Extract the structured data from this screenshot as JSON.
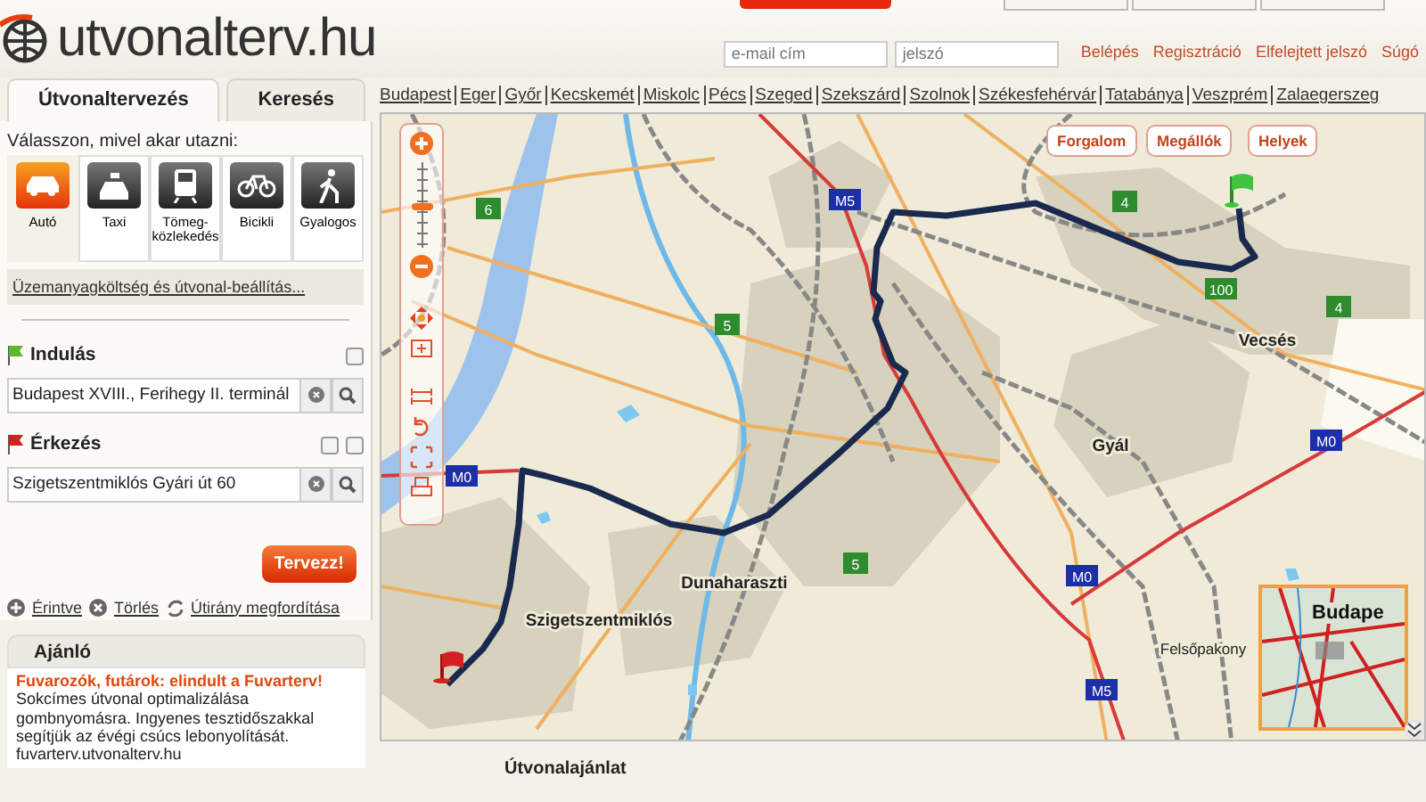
{
  "logo": "utvonalterv.hu",
  "login": {
    "email_placeholder": "e-mail cím",
    "password_placeholder": "jelszó",
    "links": [
      "Belépés",
      "Regisztráció",
      "Elfelejtett jelszó",
      "Súgó"
    ]
  },
  "city_links": [
    "Budapest",
    "Eger",
    "Győr",
    "Kecskemét",
    "Miskolc",
    "Pécs",
    "Szeged",
    "Szekszárd",
    "Szolnok",
    "Székesfehérvár",
    "Tatabánya",
    "Veszprém",
    "Zalaegerszeg"
  ],
  "tabs": [
    {
      "label": "Útvonaltervezés",
      "selected": true
    },
    {
      "label": "Keresés",
      "selected": false
    }
  ],
  "mode_prompt": "Válasszon, mivel akar utazni:",
  "modes": [
    {
      "label": "Autó",
      "kind": "car",
      "selected": true
    },
    {
      "label": "Taxi",
      "kind": "taxi",
      "selected": false
    },
    {
      "label": "Tömeg-közlekedés",
      "kind": "train",
      "selected": false
    },
    {
      "label": "Bicikli",
      "kind": "bike",
      "selected": false
    },
    {
      "label": "Gyalogos",
      "kind": "walk",
      "selected": false
    }
  ],
  "settings_link": "Üzemanyagköltség és útvonal-beállítás...",
  "origin": {
    "label": "Indulás",
    "value": "Budapest XVIII., Ferihegy II. terminál",
    "kind": "origin"
  },
  "destination": {
    "label": "Érkezés",
    "value": "Szigetszentmiklós Gyári út 60",
    "kind": "destination"
  },
  "plan_button": "Tervezz!",
  "actions": [
    {
      "label": "Érintve",
      "kind": "add"
    },
    {
      "label": "Törlés",
      "kind": "delete"
    },
    {
      "label": "Útirány megfordítása",
      "kind": "reverse"
    }
  ],
  "recommendation": {
    "title": "Ajánló",
    "headline": "Fuvarozók, futárok: elindult a Fuvarterv!",
    "body": "Sokcímes útvonal optimalizálása gombnyomásra. Ingyenes tesztidőszakkal segítjük az évégi csúcs lebonyolítását.",
    "url": "fuvarterv.utvonalterv.hu"
  },
  "map": {
    "buttons": [
      "Forgalom",
      "Megállók",
      "Helyek"
    ],
    "zoom": {
      "level": 0.5
    },
    "places": [
      "Vecsés",
      "Gyál",
      "Dunaharaszti",
      "Szigetszentmiklós",
      "Felsőpakony"
    ],
    "road_signs": [
      {
        "text": "6",
        "kind": "national"
      },
      {
        "text": "M5",
        "kind": "motorway"
      },
      {
        "text": "4",
        "kind": "national"
      },
      {
        "text": "100",
        "kind": "national"
      },
      {
        "text": "4",
        "kind": "national"
      },
      {
        "text": "5",
        "kind": "national"
      },
      {
        "text": "M0",
        "kind": "motorway"
      },
      {
        "text": "5",
        "kind": "national"
      },
      {
        "text": "M0",
        "kind": "motorway"
      },
      {
        "text": "M0",
        "kind": "motorway"
      },
      {
        "text": "M5",
        "kind": "motorway"
      }
    ],
    "overview_label": "Budape"
  },
  "results_heading": "Útvonalajánlat"
}
